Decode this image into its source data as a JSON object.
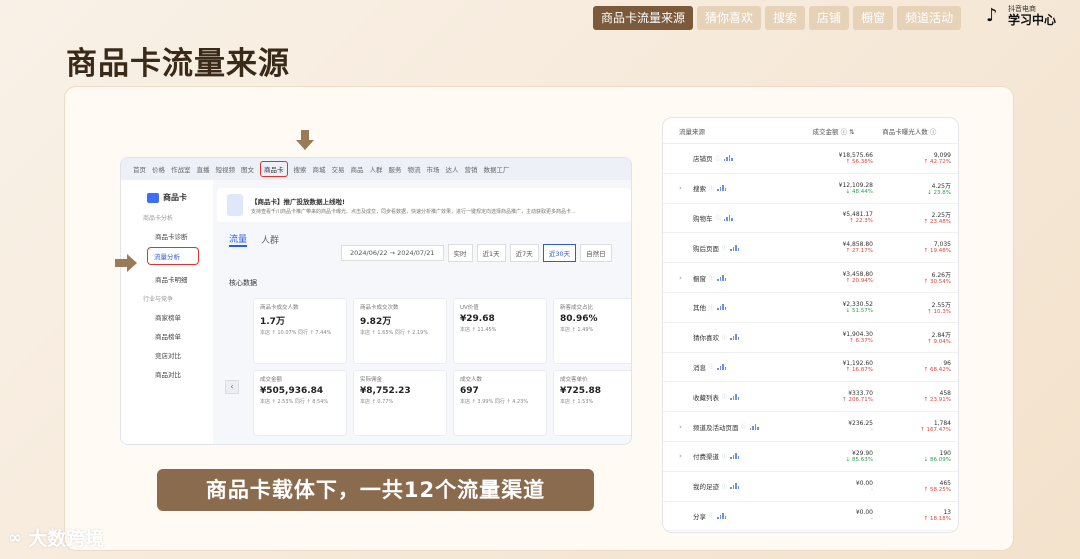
{
  "top_nav": {
    "tabs": [
      "商品卡流量来源",
      "猜你喜欢",
      "搜索",
      "店铺",
      "橱窗",
      "频道活动"
    ]
  },
  "brand": {
    "small": "抖音电商",
    "big": "学习中心"
  },
  "title": "商品卡流量来源",
  "caption": "商品卡载体下，一共12个流量渠道",
  "watermark": "大数跨境",
  "screenshot": {
    "nav_items": [
      "首页",
      "价格",
      "作战室",
      "直播",
      "短视频",
      "图文",
      "商品卡",
      "搜索",
      "商城",
      "交易",
      "商品",
      "人群",
      "服务",
      "物流",
      "市场",
      "达人",
      "营销",
      "数据工厂"
    ],
    "sidebar": {
      "logo": "商品卡",
      "sec1": "商品卡分析",
      "items1": [
        "商品卡诊断",
        "流量分析",
        "商品卡明细"
      ],
      "sec2": "行业与竞争",
      "items2": [
        "商家榜单",
        "商品榜单",
        "竞店对比",
        "商品对比"
      ]
    },
    "banner": {
      "title": "【商品卡】推广投放数据上线啦!",
      "desc": "支持查看千川商品卡推广带来的商品卡曝光、点击及成交，同步看数据，快速分析推广效果，进行一键规定向选择商品推广，主动获取更多商品卡..."
    },
    "tabs": [
      "流量",
      "人群"
    ],
    "date_start": "2024/06/22",
    "date_end": "2024/07/21",
    "date_btns": [
      "实时",
      "近1天",
      "近7天",
      "近30天",
      "自然日"
    ],
    "core_title": "核心数据",
    "metrics": [
      {
        "label": "商品卡成交人数",
        "value": "1.7万",
        "sub": "本店 ↑ 10.07%  同行 ↑ 7.44%"
      },
      {
        "label": "商品卡成交次数",
        "value": "9.82万",
        "sub": "本店 ↑ 1.65%  同行 ↑ 2.19%"
      },
      {
        "label": "UV价值",
        "value": "¥29.68",
        "sub": "本店 ↑ 11.45%"
      },
      {
        "label": "新客成交占比",
        "value": "80.96%",
        "sub": "本店 ↑ 1.49%"
      },
      {
        "label": "成交金额",
        "value": "¥505,936.84",
        "sub": "本店 ↑ 2.53%  同行 ↑ 8.54%"
      },
      {
        "label": "实际佣金",
        "value": "¥8,752.23",
        "sub": "本店 ↑ 0.77%"
      },
      {
        "label": "成交人数",
        "value": "697",
        "sub": "本店 ↑ 3.99%  同行 ↑ 4.23%"
      },
      {
        "label": "成交客单价",
        "value": "¥725.88",
        "sub": "本店 ↑ 1.53%"
      }
    ]
  },
  "traffic_panel": {
    "headers": [
      "流量来源",
      "成交金额",
      "商品卡曝光人数"
    ],
    "rows": [
      {
        "name": "店铺页",
        "expand": false,
        "gmv": "¥18,575.66",
        "gmv_ch": "↑ 56.38%",
        "gmv_dir": "up",
        "exp": "9,099",
        "exp_ch": "↑ 42.72%",
        "exp_dir": "up"
      },
      {
        "name": "搜索",
        "expand": true,
        "gmv": "¥12,109.28",
        "gmv_ch": "↓ 48.44%",
        "gmv_dir": "down",
        "exp": "4.25万",
        "exp_ch": "↓ 23.8%",
        "exp_dir": "down"
      },
      {
        "name": "购物车",
        "expand": false,
        "gmv": "¥5,481.17",
        "gmv_ch": "↑ 22.3%",
        "gmv_dir": "up",
        "exp": "2.25万",
        "exp_ch": "↑ 23.48%",
        "exp_dir": "up"
      },
      {
        "name": "购后页面",
        "expand": false,
        "gmv": "¥4,858.80",
        "gmv_ch": "↑ 27.17%",
        "gmv_dir": "up",
        "exp": "7,035",
        "exp_ch": "↑ 19.48%",
        "exp_dir": "up"
      },
      {
        "name": "橱窗",
        "expand": true,
        "gmv": "¥3,458.80",
        "gmv_ch": "↑ 20.94%",
        "gmv_dir": "up",
        "exp": "6.26万",
        "exp_ch": "↑ 30.54%",
        "exp_dir": "up"
      },
      {
        "name": "其他",
        "expand": false,
        "gmv": "¥2,330.52",
        "gmv_ch": "↓ 51.57%",
        "gmv_dir": "down",
        "exp": "2.55万",
        "exp_ch": "↑ 10.3%",
        "exp_dir": "up"
      },
      {
        "name": "猜你喜欢",
        "expand": false,
        "gmv": "¥1,904.30",
        "gmv_ch": "↑ 6.37%",
        "gmv_dir": "up",
        "exp": "2.84万",
        "exp_ch": "↑ 9.04%",
        "exp_dir": "up"
      },
      {
        "name": "消息",
        "expand": false,
        "gmv": "¥1,192.60",
        "gmv_ch": "↑ 16.87%",
        "gmv_dir": "up",
        "exp": "96",
        "exp_ch": "↑ 68.42%",
        "exp_dir": "up"
      },
      {
        "name": "收藏列表",
        "expand": false,
        "gmv": "¥333.70",
        "gmv_ch": "↑ 206.71%",
        "gmv_dir": "up",
        "exp": "458",
        "exp_ch": "↑ 23.91%",
        "exp_dir": "up"
      },
      {
        "name": "频道及活动页面",
        "expand": true,
        "gmv": "¥236.25",
        "gmv_ch": "-",
        "gmv_dir": "flat",
        "exp": "1,784",
        "exp_ch": "↑ 167.47%",
        "exp_dir": "up"
      },
      {
        "name": "付费渠道",
        "expand": true,
        "gmv": "¥29.90",
        "gmv_ch": "↓ 85.63%",
        "gmv_dir": "down",
        "exp": "190",
        "exp_ch": "↓ 86.09%",
        "exp_dir": "down"
      },
      {
        "name": "我的足迹",
        "expand": false,
        "gmv": "¥0.00",
        "gmv_ch": "-",
        "gmv_dir": "flat",
        "exp": "465",
        "exp_ch": "↑ 58.25%",
        "exp_dir": "up"
      },
      {
        "name": "分享",
        "expand": false,
        "gmv": "¥0.00",
        "gmv_ch": "-",
        "gmv_dir": "flat",
        "exp": "13",
        "exp_ch": "↑ 18.18%",
        "exp_dir": "up"
      }
    ]
  }
}
